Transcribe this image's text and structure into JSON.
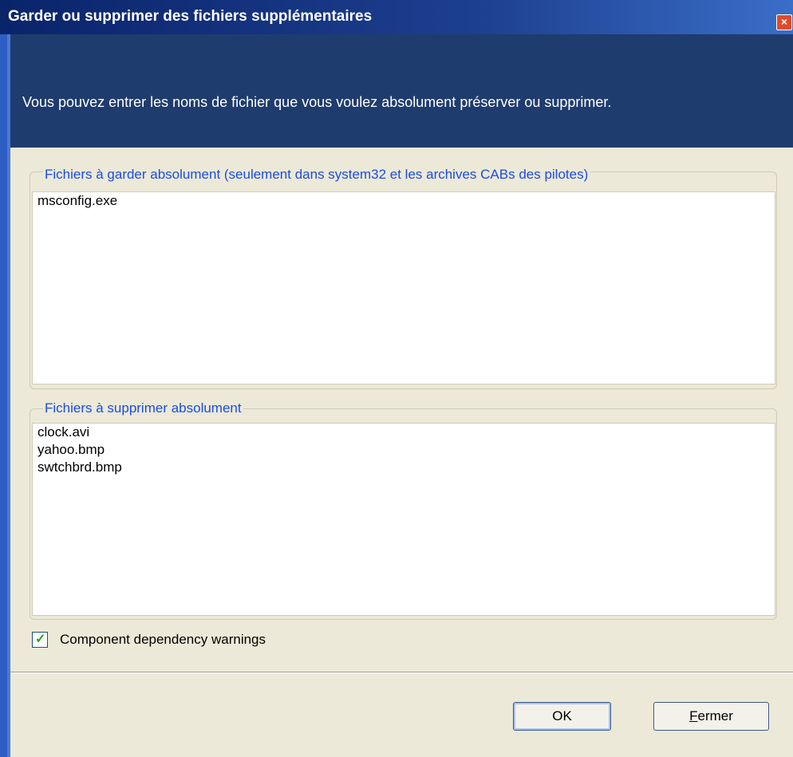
{
  "window": {
    "title": "Garder ou supprimer des fichiers supplémentaires",
    "close_glyph": "×"
  },
  "header": {
    "description": "Vous pouvez entrer les noms de fichier que vous voulez absolument préserver ou supprimer."
  },
  "keep_group": {
    "legend": "Fichiers à garder absolument (seulement dans system32 et les archives CABs des pilotes)",
    "items": [
      "msconfig.exe"
    ]
  },
  "delete_group": {
    "legend": "Fichiers à supprimer absolument",
    "items": [
      "clock.avi",
      "yahoo.bmp",
      "swtchbrd.bmp"
    ]
  },
  "dependency_warnings": {
    "label": "Component dependency warnings",
    "checked": true,
    "check_glyph": "✓"
  },
  "buttons": {
    "ok_label": "OK",
    "close_mnemonic": "F",
    "close_rest": "ermer"
  },
  "colors": {
    "titlebar": "#0a246a",
    "header": "#1f3c6e",
    "legend_text": "#1a4de0",
    "dialog_bg": "#ece9d8"
  }
}
